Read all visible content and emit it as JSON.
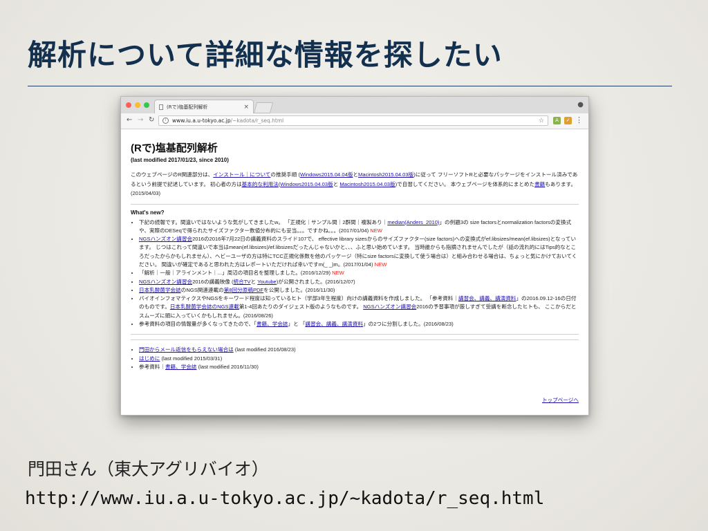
{
  "slide": {
    "title": "解析について詳細な情報を探したい",
    "speaker": "門田さん（東大アグリバイオ）",
    "url": "http://www.iu.a.u-tokyo.ac.jp/~kadota/r_seq.html"
  },
  "browser": {
    "tab_title": "(Rで)塩基配列解析",
    "address_host": "www.iu.a.u-tokyo.ac.jp",
    "address_path": "/~kadota/r_seq.html",
    "colors": {
      "close": "#fc5f57",
      "minimize": "#fdbc2e",
      "zoom": "#34c84a",
      "link": "#1a0dab",
      "new": "#e8211a"
    }
  },
  "page": {
    "heading": "(Rで)塩基配列解析",
    "last_modified": "(last modified 2017/01/23, since 2010)",
    "intro": [
      {
        "t": "このウェブページのR関連部分は、"
      },
      {
        "t": "インストール｜について",
        "link": true
      },
      {
        "t": "の推奨手順 ("
      },
      {
        "t": "Windows2015.04.04版",
        "link": true
      },
      {
        "t": "と"
      },
      {
        "t": "Macintosh2015.04.03版",
        "link": true
      },
      {
        "t": ")に従って フリーソフトRと必要なパッケージをインストール済みであるという前提で記述しています。 初心者の方は"
      },
      {
        "t": "基本的な利用法",
        "link": true
      },
      {
        "t": "("
      },
      {
        "t": "Windows2015.04.03版",
        "link": true
      },
      {
        "t": "と "
      },
      {
        "t": "Macintosh2015.04.03版",
        "link": true
      },
      {
        "t": ")で自習してください。 本ウェブページを体系的にまとめた"
      },
      {
        "t": "書籍",
        "link": true
      },
      {
        "t": "もあります。(2015/04/03)"
      }
    ],
    "whats_new_label": "What's new?",
    "news": [
      [
        {
          "t": "下記の続報です。間違いではないような気がしてきましたw。 「正規化｜サンプル間｜2群間｜複製あり｜"
        },
        {
          "t": "median(Anders_2010)",
          "link": true
        },
        {
          "t": "」の例題3の size factorsとnormalization factorsの変換式や、実際のDESeqで得られたサイズファクター数値分布的にも妥当。。。ですかね。。。(2017/01/04) "
        },
        {
          "t": "NEW",
          "new": true
        }
      ],
      [
        {
          "t": "NGSハンズオン講習会",
          "link": true
        },
        {
          "t": "2016の2016年7月22日の講義資料のスライド107で、 effective library sizesからのサイズファクター(size factors)への変換式がef.libsizes/mean(ef.libsizes)となっています。 じつはこれって間違いで本当はmean(ef.libsizes)/ef.libsizesだったんじゃないかと、、、ふと思い始めています。 当時誰からも指摘されませんでしたが（話の流れ的にはTips的なところだったからかもしれません）、ヘビーユーザの方は特にTCC正規化係数を他のパッケージ（特にsize factorsに変換して使う場合は）と組み合わせる場合は、ちょっと気にかけておいてください。 間違いが確定であると思われた方はレポートいただければ幸いですm(_ _)m。(2017/01/04) "
        },
        {
          "t": "NEW",
          "new": true
        }
      ],
      [
        {
          "t": "「解析｜一般｜アラインメント｜...」周辺の項目名を整理しました。(2016/12/29) "
        },
        {
          "t": "NEW",
          "new": true
        }
      ],
      [
        {
          "t": "NGSハンズオン講習会",
          "link": true
        },
        {
          "t": "2016の講義映像 ("
        },
        {
          "t": "統合TV",
          "link": true
        },
        {
          "t": "と "
        },
        {
          "t": "Youtube",
          "link": true
        },
        {
          "t": ")が公開されました。(2016/12/07)"
        }
      ],
      [
        {
          "t": "日本乳酸菌学会誌",
          "link": true
        },
        {
          "t": "のNGS関連連載の"
        },
        {
          "t": "第8回分原稿PDF",
          "link": true
        },
        {
          "t": "を公開しました。(2016/11/30)"
        }
      ],
      [
        {
          "t": "バイオインフォマティクスやNGSをキーワード程度は知っているヒト（学部3年生程度）向けの講義資料を作成しました。 「参考資料｜"
        },
        {
          "t": "講習会、講義、講演資料",
          "link": true
        },
        {
          "t": "」の2016.09.12-16の日付のものです。"
        },
        {
          "t": "日本乳酸菌学会誌のNGS連載",
          "link": true
        },
        {
          "t": "第1-4回あたりのダイジェスト版のようなものです。 "
        },
        {
          "t": "NGSハンズオン講習会",
          "link": true
        },
        {
          "t": "2016の予習事項が厳しすぎて受講を断念したヒトも、 ここからだとスムーズに頭に入っていくかもしれません。(2016/08/26)"
        }
      ],
      [
        {
          "t": "参考資料の項目の情報量が多くなってきたので、「"
        },
        {
          "t": "書籍、学会誌",
          "link": true
        },
        {
          "t": "」と 「"
        },
        {
          "t": "講習会、講義、講演資料",
          "link": true
        },
        {
          "t": "」の2つに分割しました。(2016/08/23)"
        }
      ]
    ],
    "misc": [
      [
        {
          "t": "門田からメール返信をもらえない場合は",
          "link": true
        },
        {
          "t": " (last modified 2016/08/23)"
        }
      ],
      [
        {
          "t": "はじめに",
          "link": true
        },
        {
          "t": " (last modified 2015/03/31)"
        }
      ],
      [
        {
          "t": "参考資料｜"
        },
        {
          "t": "書籍、学会誌",
          "link": true
        },
        {
          "t": " (last modified 2016/11/30)"
        }
      ]
    ],
    "top_link": "トップページへ"
  }
}
